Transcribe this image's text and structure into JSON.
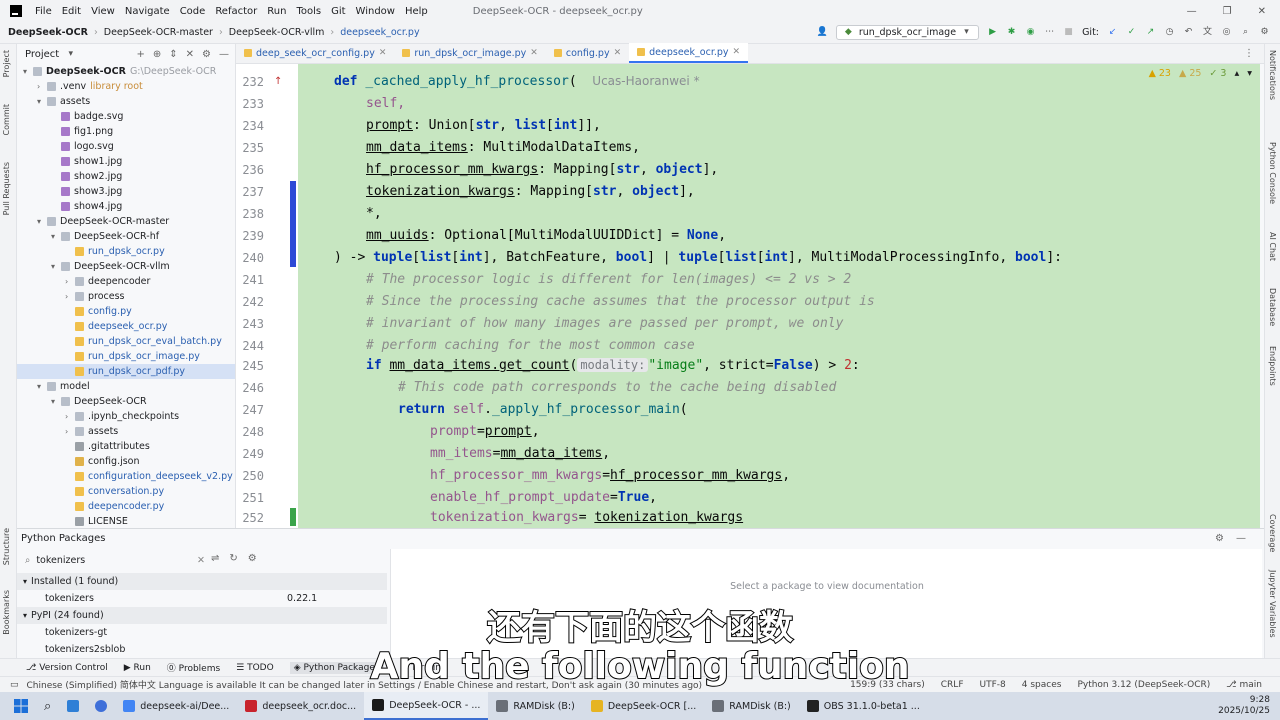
{
  "titlebar": {
    "menu": [
      "File",
      "Edit",
      "View",
      "Navigate",
      "Code",
      "Refactor",
      "Run",
      "Tools",
      "Git",
      "Window",
      "Help"
    ],
    "window_title": "DeepSeek-OCR - deepseek_ocr.py"
  },
  "navbar": {
    "crumbs": [
      "DeepSeek-OCR",
      "DeepSeek-OCR-master",
      "DeepSeek-OCR-vllm",
      "deepseek_ocr.py"
    ],
    "run_config": "run_dpsk_ocr_image",
    "git_label": "Git:"
  },
  "left_stripe": [
    "Project",
    "Commit",
    "Pull Requests",
    "Structure",
    "Bookmarks"
  ],
  "right_stripe": [
    "Notifications",
    "Python Console",
    "AI Chat",
    "Database",
    "Endpoints",
    "Coverage",
    "Jupyter Variables"
  ],
  "project": {
    "title": "Project",
    "tree": [
      {
        "label": "DeepSeek-OCR",
        "hint": "G:\\DeepSeek-OCR",
        "depth": 0,
        "type": "folder",
        "open": true
      },
      {
        "label": ".venv",
        "hint": "library root",
        "depth": 1,
        "type": "folder",
        "open": false
      },
      {
        "label": "assets",
        "depth": 1,
        "type": "folder",
        "open": true
      },
      {
        "label": "badge.svg",
        "depth": 2,
        "type": "img"
      },
      {
        "label": "fig1.png",
        "depth": 2,
        "type": "img"
      },
      {
        "label": "logo.svg",
        "depth": 2,
        "type": "img"
      },
      {
        "label": "show1.jpg",
        "depth": 2,
        "type": "img"
      },
      {
        "label": "show2.jpg",
        "depth": 2,
        "type": "img"
      },
      {
        "label": "show3.jpg",
        "depth": 2,
        "type": "img"
      },
      {
        "label": "show4.jpg",
        "depth": 2,
        "type": "img"
      },
      {
        "label": "DeepSeek-OCR-master",
        "depth": 1,
        "type": "folder",
        "open": true
      },
      {
        "label": "DeepSeek-OCR-hf",
        "depth": 2,
        "type": "folder",
        "open": true
      },
      {
        "label": "run_dpsk_ocr.py",
        "depth": 3,
        "type": "py"
      },
      {
        "label": "DeepSeek-OCR-vllm",
        "depth": 2,
        "type": "folder",
        "open": true
      },
      {
        "label": "deepencoder",
        "depth": 3,
        "type": "folder",
        "open": false
      },
      {
        "label": "process",
        "depth": 3,
        "type": "folder",
        "open": false
      },
      {
        "label": "config.py",
        "depth": 3,
        "type": "py"
      },
      {
        "label": "deepseek_ocr.py",
        "depth": 3,
        "type": "py"
      },
      {
        "label": "run_dpsk_ocr_eval_batch.py",
        "depth": 3,
        "type": "py"
      },
      {
        "label": "run_dpsk_ocr_image.py",
        "depth": 3,
        "type": "py"
      },
      {
        "label": "run_dpsk_ocr_pdf.py",
        "depth": 3,
        "type": "py",
        "selected": true
      },
      {
        "label": "model",
        "depth": 1,
        "type": "folder",
        "open": true
      },
      {
        "label": "DeepSeek-OCR",
        "depth": 2,
        "type": "folder",
        "open": true
      },
      {
        "label": ".ipynb_checkpoints",
        "depth": 3,
        "type": "folder",
        "open": false
      },
      {
        "label": "assets",
        "depth": 3,
        "type": "folder",
        "open": false
      },
      {
        "label": ".gitattributes",
        "depth": 3,
        "type": "txt"
      },
      {
        "label": "config.json",
        "depth": 3,
        "type": "json"
      },
      {
        "label": "configuration_deepseek_v2.py",
        "depth": 3,
        "type": "py"
      },
      {
        "label": "conversation.py",
        "depth": 3,
        "type": "py"
      },
      {
        "label": "deepencoder.py",
        "depth": 3,
        "type": "py"
      },
      {
        "label": "LICENSE",
        "depth": 3,
        "type": "txt"
      }
    ]
  },
  "tabs": [
    {
      "label": "deep_seek_ocr_config.py",
      "active": false
    },
    {
      "label": "run_dpsk_ocr_image.py",
      "active": false
    },
    {
      "label": "config.py",
      "active": false
    },
    {
      "label": "deepseek_ocr.py",
      "active": true
    }
  ],
  "inspections": {
    "warnings": "23",
    "weak": "25",
    "typos": "3"
  },
  "code": {
    "line_numbers": [
      "232",
      "233",
      "234",
      "235",
      "236",
      "237",
      "238",
      "239",
      "240",
      "241",
      "242",
      "243",
      "244",
      "245",
      "246",
      "247",
      "248",
      "249",
      "250",
      "251",
      "252"
    ],
    "l232_def": "def ",
    "l232_name": "_cached_apply_hf_processor",
    "l232_paren": "(",
    "l232_author": "Ucas-Haoranwei *",
    "l233": "self,",
    "l234_param": "prompt",
    "l234_rest1": ": Union[",
    "l234_str": "str",
    "l234_sep": ", ",
    "l234_list": "list",
    "l234_b": "[",
    "l234_int": "int",
    "l234_end": "]],",
    "l235_param": "mm_data_items",
    "l235_rest": ": MultiModalDataItems,",
    "l236_param": "hf_processor_mm_kwargs",
    "l236_rest1": ": Mapping[",
    "l236_str": "str",
    "l236_sep": ", ",
    "l236_obj": "object",
    "l236_end": "],",
    "l237_param": "tokenization_kwargs",
    "l237_rest1": ": Mapping[",
    "l237_str": "str",
    "l237_sep": ", ",
    "l237_obj": "object",
    "l237_end": "],",
    "l238": "*,",
    "l239_param": "mm_uuids",
    "l239_rest": ": Optional[MultiModalUUIDDict] = ",
    "l239_none": "None",
    "l239_end": ",",
    "l240_a": ") -> ",
    "l240_tuple": "tuple",
    "l240_b": "[",
    "l240_list": "list",
    "l240_c": "[",
    "l240_int": "int",
    "l240_d": "], BatchFeature, ",
    "l240_bool": "bool",
    "l240_e": "] | ",
    "l240_tuple2": "tuple",
    "l240_f": "[",
    "l240_list2": "list",
    "l240_g": "[",
    "l240_int2": "int",
    "l240_h": "], MultiModalProcessingInfo, ",
    "l240_bool2": "bool",
    "l240_i": "]:",
    "l241": "# The processor logic is different for len(images) <= 2 vs > 2",
    "l242": "# Since the processing cache assumes that the processor output is",
    "l243": "# invariant of how many images are passed per prompt, we only",
    "l244": "# perform caching for the most common case",
    "l245_if": "if ",
    "l245_call": "mm_data_items.get_count",
    "l245_p": "(",
    "l245_hint": "modality:",
    "l245_str": "\"image\"",
    "l245_mid": ", strict=",
    "l245_false": "False",
    "l245_gt": ") > ",
    "l245_num": "2",
    "l245_end": ":",
    "l246": "# This code path corresponds to the cache being disabled",
    "l247_ret": "return ",
    "l247_self": "self",
    "l247_dot": ".",
    "l247_fn": "_apply_hf_processor_main",
    "l247_p": "(",
    "l248_k": "prompt",
    "l248_eq": "=",
    "l248_v": "prompt",
    "l248_c": ",",
    "l249_k": "mm_items",
    "l249_eq": "=",
    "l249_v": "mm_data_items",
    "l249_c": ",",
    "l250_k": "hf_processor_mm_kwargs",
    "l250_eq": "=",
    "l250_v": "hf_processor_mm_kwargs",
    "l250_c": ",",
    "l251_k": "enable_hf_prompt_update",
    "l251_eq": "=",
    "l251_v": "True",
    "l251_c": ",",
    "l252_k": "tokenization_kwargs",
    "l252_eq": "= ",
    "l252_v": "tokenization_kwargs"
  },
  "packages": {
    "title": "Python Packages",
    "search_value": "tokenizers",
    "installed_header": "Installed (1 found)",
    "installed": [
      {
        "name": "tokenizers",
        "version": "0.22.1"
      }
    ],
    "pypi_header": "PyPI (24 found)",
    "pypi": [
      "tokenizers-gt",
      "tokenizers2sblob"
    ],
    "doc_placeholder": "Select a package to view documentation"
  },
  "bottom_tools": [
    "Version Control",
    "Run",
    "Problems",
    "TODO",
    "Python Packages",
    "Termin"
  ],
  "statusbar": {
    "message": "Chinese (Simplified) 简体中文 Language is available It can be changed later in Settings / Enable Chinese and restart, Don't ask again (30 minutes ago)",
    "position": "159:9 (33 chars)",
    "line_sep": "CRLF",
    "encoding": "UTF-8",
    "indent": "4 spaces",
    "interpreter": "Python 3.12 (DeepSeek-OCR)",
    "branch": "main"
  },
  "taskbar": {
    "items": [
      {
        "label": "deepseek-ai/Dee...",
        "color": "#4285f4"
      },
      {
        "label": "deepseek_ocr.doc...",
        "color": "#c8232c"
      },
      {
        "label": "DeepSeek-OCR - ...",
        "color": "#1a1a1a",
        "active": true
      },
      {
        "label": "RAMDisk (B:)",
        "color": "#6a6f78"
      },
      {
        "label": "DeepSeek-OCR [...",
        "color": "#e6b422"
      },
      {
        "label": "RAMDisk (B:)",
        "color": "#6a6f78"
      },
      {
        "label": "OBS 31.1.0-beta1 ...",
        "color": "#222222"
      }
    ],
    "time": "9:28",
    "date": "2025/10/25"
  },
  "subtitles": {
    "zh": "还有下面的这个函数",
    "en": "And the following function"
  }
}
